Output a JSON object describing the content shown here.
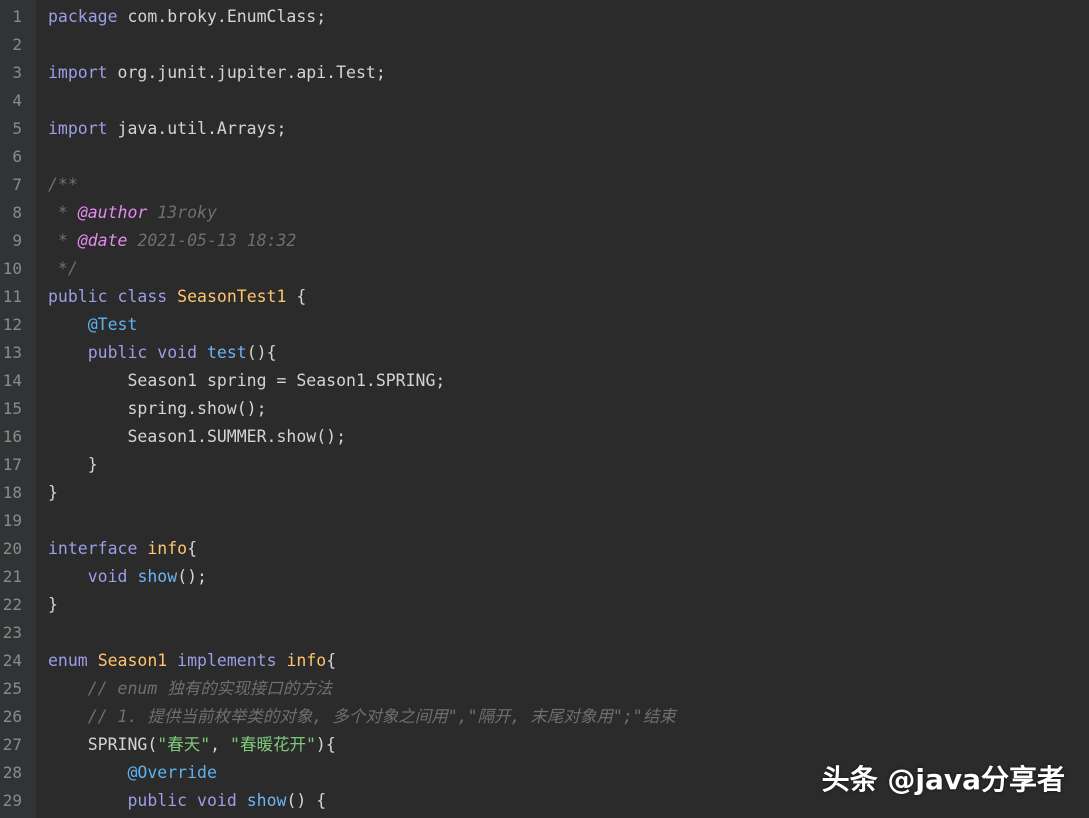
{
  "watermark": "头条 @java分享者",
  "colors": {
    "background": "#2b2b2b",
    "gutter": "#313335",
    "line_number": "#8a8a8a",
    "keyword": "#9d9de8",
    "class_name": "#ffc66d",
    "function": "#6fb3f5",
    "string": "#7fc87a",
    "comment": "#6f6f6f",
    "doc_tag": "#e58af0",
    "annotation": "#5fb2f0",
    "plain": "#d4d4d4"
  },
  "lines": [
    {
      "num": "1",
      "tokens": [
        {
          "t": "kw",
          "v": "package"
        },
        {
          "t": "plain",
          "v": " com.broky.EnumClass;"
        }
      ]
    },
    {
      "num": "2",
      "tokens": []
    },
    {
      "num": "3",
      "tokens": [
        {
          "t": "kw",
          "v": "import"
        },
        {
          "t": "plain",
          "v": " org.junit.jupiter.api.Test;"
        }
      ]
    },
    {
      "num": "4",
      "tokens": []
    },
    {
      "num": "5",
      "tokens": [
        {
          "t": "kw",
          "v": "import"
        },
        {
          "t": "plain",
          "v": " java.util.Arrays;"
        }
      ]
    },
    {
      "num": "6",
      "tokens": []
    },
    {
      "num": "7",
      "tokens": [
        {
          "t": "cmt",
          "v": "/**"
        }
      ]
    },
    {
      "num": "8",
      "tokens": [
        {
          "t": "cmt",
          "v": " * "
        },
        {
          "t": "tag",
          "v": "@author"
        },
        {
          "t": "cmt",
          "v": " 13roky"
        }
      ]
    },
    {
      "num": "9",
      "tokens": [
        {
          "t": "cmt",
          "v": " * "
        },
        {
          "t": "tag",
          "v": "@date"
        },
        {
          "t": "cmt",
          "v": " 2021-05-13 18:32"
        }
      ]
    },
    {
      "num": "10",
      "tokens": [
        {
          "t": "cmt",
          "v": " */"
        }
      ]
    },
    {
      "num": "11",
      "tokens": [
        {
          "t": "kw",
          "v": "public"
        },
        {
          "t": "plain",
          "v": " "
        },
        {
          "t": "kw",
          "v": "class"
        },
        {
          "t": "plain",
          "v": " "
        },
        {
          "t": "cls",
          "v": "SeasonTest1"
        },
        {
          "t": "plain",
          "v": " {"
        }
      ]
    },
    {
      "num": "12",
      "tokens": [
        {
          "t": "plain",
          "v": "    "
        },
        {
          "t": "ann",
          "v": "@Test"
        }
      ]
    },
    {
      "num": "13",
      "tokens": [
        {
          "t": "plain",
          "v": "    "
        },
        {
          "t": "kw",
          "v": "public"
        },
        {
          "t": "plain",
          "v": " "
        },
        {
          "t": "kw",
          "v": "void"
        },
        {
          "t": "plain",
          "v": " "
        },
        {
          "t": "fn",
          "v": "test"
        },
        {
          "t": "plain",
          "v": "(){"
        }
      ]
    },
    {
      "num": "14",
      "tokens": [
        {
          "t": "plain",
          "v": "        Season1 spring = Season1.SPRING;"
        }
      ]
    },
    {
      "num": "15",
      "tokens": [
        {
          "t": "plain",
          "v": "        spring.show();"
        }
      ]
    },
    {
      "num": "16",
      "tokens": [
        {
          "t": "plain",
          "v": "        Season1.SUMMER.show();"
        }
      ]
    },
    {
      "num": "17",
      "tokens": [
        {
          "t": "plain",
          "v": "    }"
        }
      ]
    },
    {
      "num": "18",
      "tokens": [
        {
          "t": "plain",
          "v": "}"
        }
      ]
    },
    {
      "num": "19",
      "tokens": []
    },
    {
      "num": "20",
      "tokens": [
        {
          "t": "kw",
          "v": "interface"
        },
        {
          "t": "plain",
          "v": " "
        },
        {
          "t": "cls",
          "v": "info"
        },
        {
          "t": "plain",
          "v": "{"
        }
      ]
    },
    {
      "num": "21",
      "tokens": [
        {
          "t": "plain",
          "v": "    "
        },
        {
          "t": "kw",
          "v": "void"
        },
        {
          "t": "plain",
          "v": " "
        },
        {
          "t": "fn",
          "v": "show"
        },
        {
          "t": "plain",
          "v": "();"
        }
      ]
    },
    {
      "num": "22",
      "tokens": [
        {
          "t": "plain",
          "v": "}"
        }
      ]
    },
    {
      "num": "23",
      "tokens": []
    },
    {
      "num": "24",
      "tokens": [
        {
          "t": "kw",
          "v": "enum"
        },
        {
          "t": "plain",
          "v": " "
        },
        {
          "t": "cls",
          "v": "Season1"
        },
        {
          "t": "plain",
          "v": " "
        },
        {
          "t": "kw",
          "v": "implements"
        },
        {
          "t": "plain",
          "v": " "
        },
        {
          "t": "cls",
          "v": "info"
        },
        {
          "t": "plain",
          "v": "{"
        }
      ]
    },
    {
      "num": "25",
      "tokens": [
        {
          "t": "plain",
          "v": "    "
        },
        {
          "t": "cmt",
          "v": "// enum 独有的实现接口的方法"
        }
      ]
    },
    {
      "num": "26",
      "tokens": [
        {
          "t": "plain",
          "v": "    "
        },
        {
          "t": "cmt",
          "v": "// 1. 提供当前枚举类的对象, 多个对象之间用\",\"隔开, 末尾对象用\";\"结束"
        }
      ]
    },
    {
      "num": "27",
      "tokens": [
        {
          "t": "plain",
          "v": "    SPRING("
        },
        {
          "t": "str",
          "v": "\"春天\""
        },
        {
          "t": "plain",
          "v": ", "
        },
        {
          "t": "str",
          "v": "\"春暖花开\""
        },
        {
          "t": "plain",
          "v": "){"
        }
      ]
    },
    {
      "num": "28",
      "tokens": [
        {
          "t": "plain",
          "v": "        "
        },
        {
          "t": "ann",
          "v": "@Override"
        }
      ]
    },
    {
      "num": "29",
      "tokens": [
        {
          "t": "plain",
          "v": "        "
        },
        {
          "t": "kw",
          "v": "public"
        },
        {
          "t": "plain",
          "v": " "
        },
        {
          "t": "kw",
          "v": "void"
        },
        {
          "t": "plain",
          "v": " "
        },
        {
          "t": "fn",
          "v": "show"
        },
        {
          "t": "plain",
          "v": "() {"
        }
      ]
    }
  ]
}
